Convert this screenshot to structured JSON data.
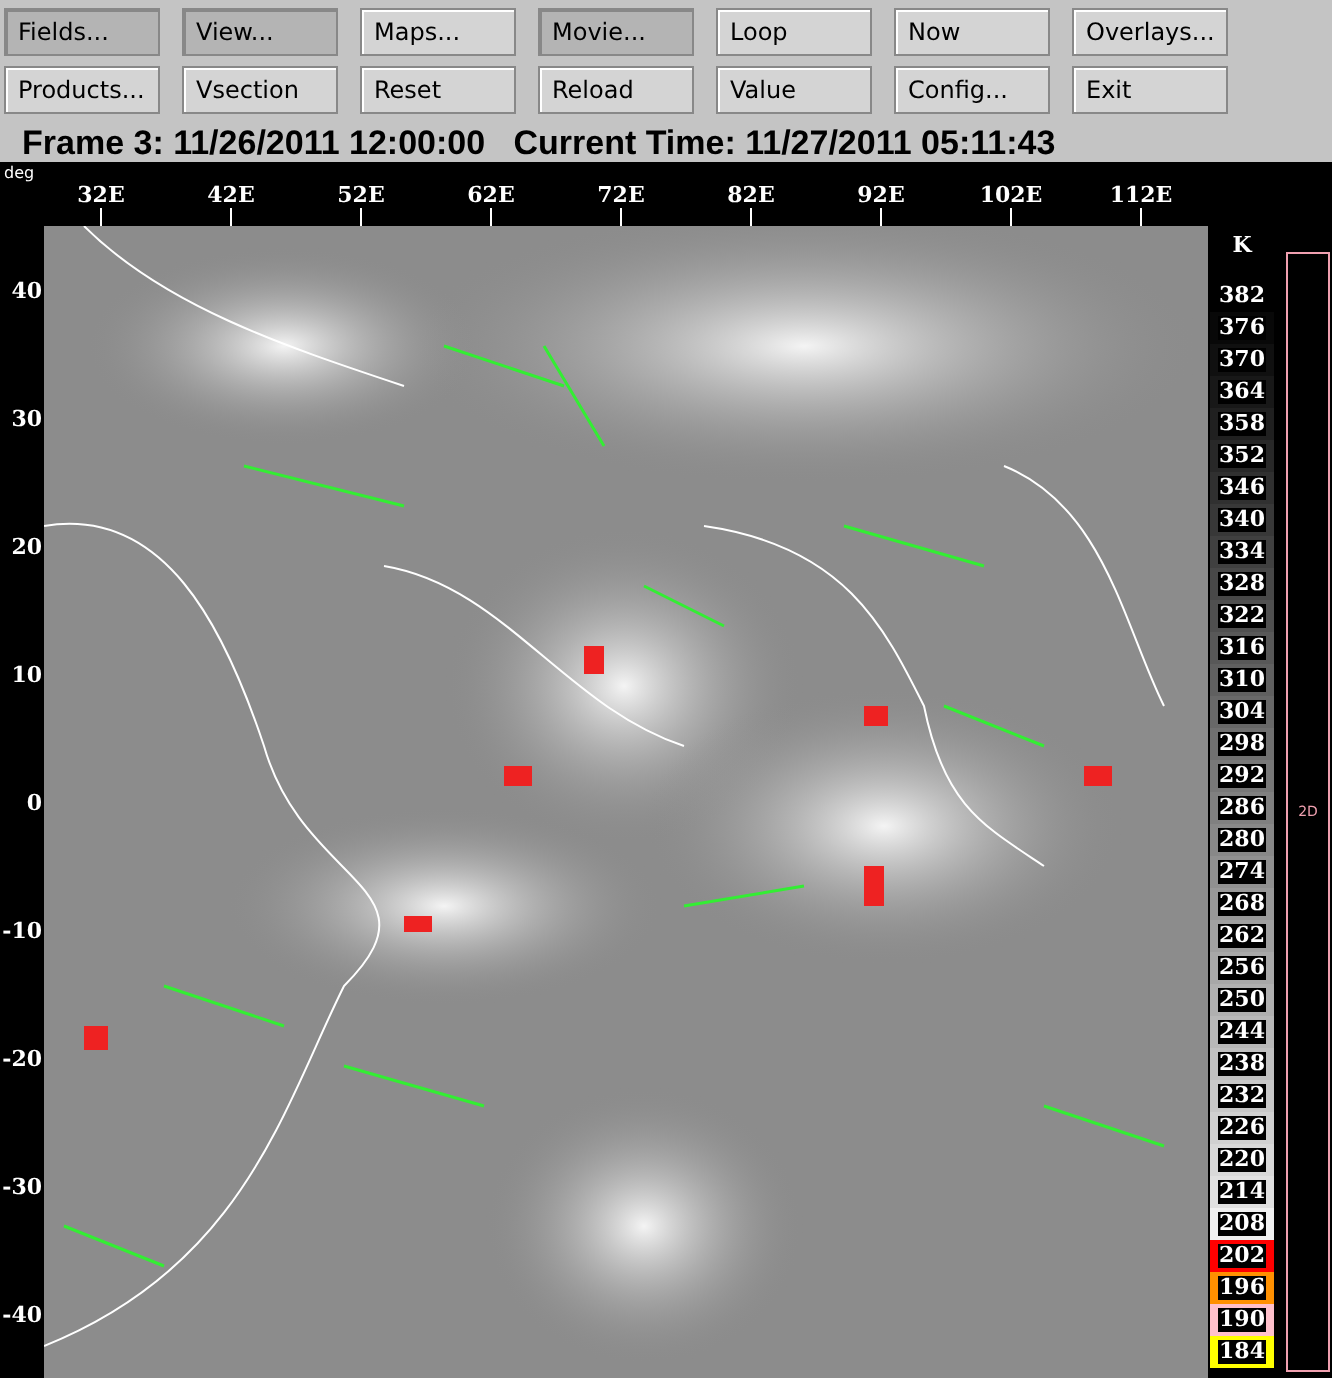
{
  "toolbar": {
    "buttons": [
      {
        "label": "Fields...",
        "pressed": true
      },
      {
        "label": "View...",
        "pressed": true
      },
      {
        "label": "Maps...",
        "pressed": false
      },
      {
        "label": "Movie...",
        "pressed": true
      },
      {
        "label": "Loop",
        "pressed": false
      },
      {
        "label": "Now",
        "pressed": false
      },
      {
        "label": "Overlays...",
        "pressed": false
      },
      {
        "label": "Products...",
        "pressed": false
      },
      {
        "label": "Vsection",
        "pressed": false
      },
      {
        "label": "Reset",
        "pressed": false
      },
      {
        "label": "Reload",
        "pressed": false
      },
      {
        "label": "Value",
        "pressed": false
      },
      {
        "label": "Config...",
        "pressed": false
      },
      {
        "label": "Exit",
        "pressed": false
      }
    ]
  },
  "frame_title": "Frame 3: 11/26/2011 12:00:00   Current Time: 11/27/2011 05:11:43",
  "map": {
    "axis_unit": "deg",
    "longitude_labels": [
      "32E",
      "42E",
      "52E",
      "62E",
      "72E",
      "82E",
      "92E",
      "102E",
      "112E"
    ],
    "latitude_labels": [
      "40",
      "30",
      "20",
      "10",
      "0",
      "-10",
      "-20",
      "-30",
      "-40"
    ]
  },
  "color_bar": {
    "unit": "K",
    "entries": [
      {
        "label": "382",
        "color": "#000000"
      },
      {
        "label": "376",
        "color": "#080808"
      },
      {
        "label": "370",
        "color": "#101010"
      },
      {
        "label": "364",
        "color": "#181818"
      },
      {
        "label": "358",
        "color": "#202020"
      },
      {
        "label": "352",
        "color": "#282828"
      },
      {
        "label": "346",
        "color": "#303030"
      },
      {
        "label": "340",
        "color": "#383838"
      },
      {
        "label": "334",
        "color": "#404040"
      },
      {
        "label": "328",
        "color": "#484848"
      },
      {
        "label": "322",
        "color": "#505050"
      },
      {
        "label": "316",
        "color": "#585858"
      },
      {
        "label": "310",
        "color": "#606060"
      },
      {
        "label": "304",
        "color": "#686868"
      },
      {
        "label": "298",
        "color": "#707070"
      },
      {
        "label": "292",
        "color": "#787878"
      },
      {
        "label": "286",
        "color": "#808080"
      },
      {
        "label": "280",
        "color": "#888888"
      },
      {
        "label": "274",
        "color": "#909090"
      },
      {
        "label": "268",
        "color": "#989898"
      },
      {
        "label": "262",
        "color": "#a0a0a0"
      },
      {
        "label": "256",
        "color": "#a8a8a8"
      },
      {
        "label": "250",
        "color": "#b0b0b0"
      },
      {
        "label": "244",
        "color": "#b8b8b8"
      },
      {
        "label": "238",
        "color": "#c0c0c0"
      },
      {
        "label": "232",
        "color": "#c8c8c8"
      },
      {
        "label": "226",
        "color": "#d0d0d0"
      },
      {
        "label": "220",
        "color": "#d8d8d8"
      },
      {
        "label": "214",
        "color": "#e0e0e0"
      },
      {
        "label": "208",
        "color": "#f0f0f0"
      },
      {
        "label": "202",
        "color": "#ff0000"
      },
      {
        "label": "196",
        "color": "#ff9000"
      },
      {
        "label": "190",
        "color": "#ffc0cb"
      },
      {
        "label": "184",
        "color": "#ffff00"
      }
    ]
  },
  "mode_panel": {
    "label": "2D"
  }
}
